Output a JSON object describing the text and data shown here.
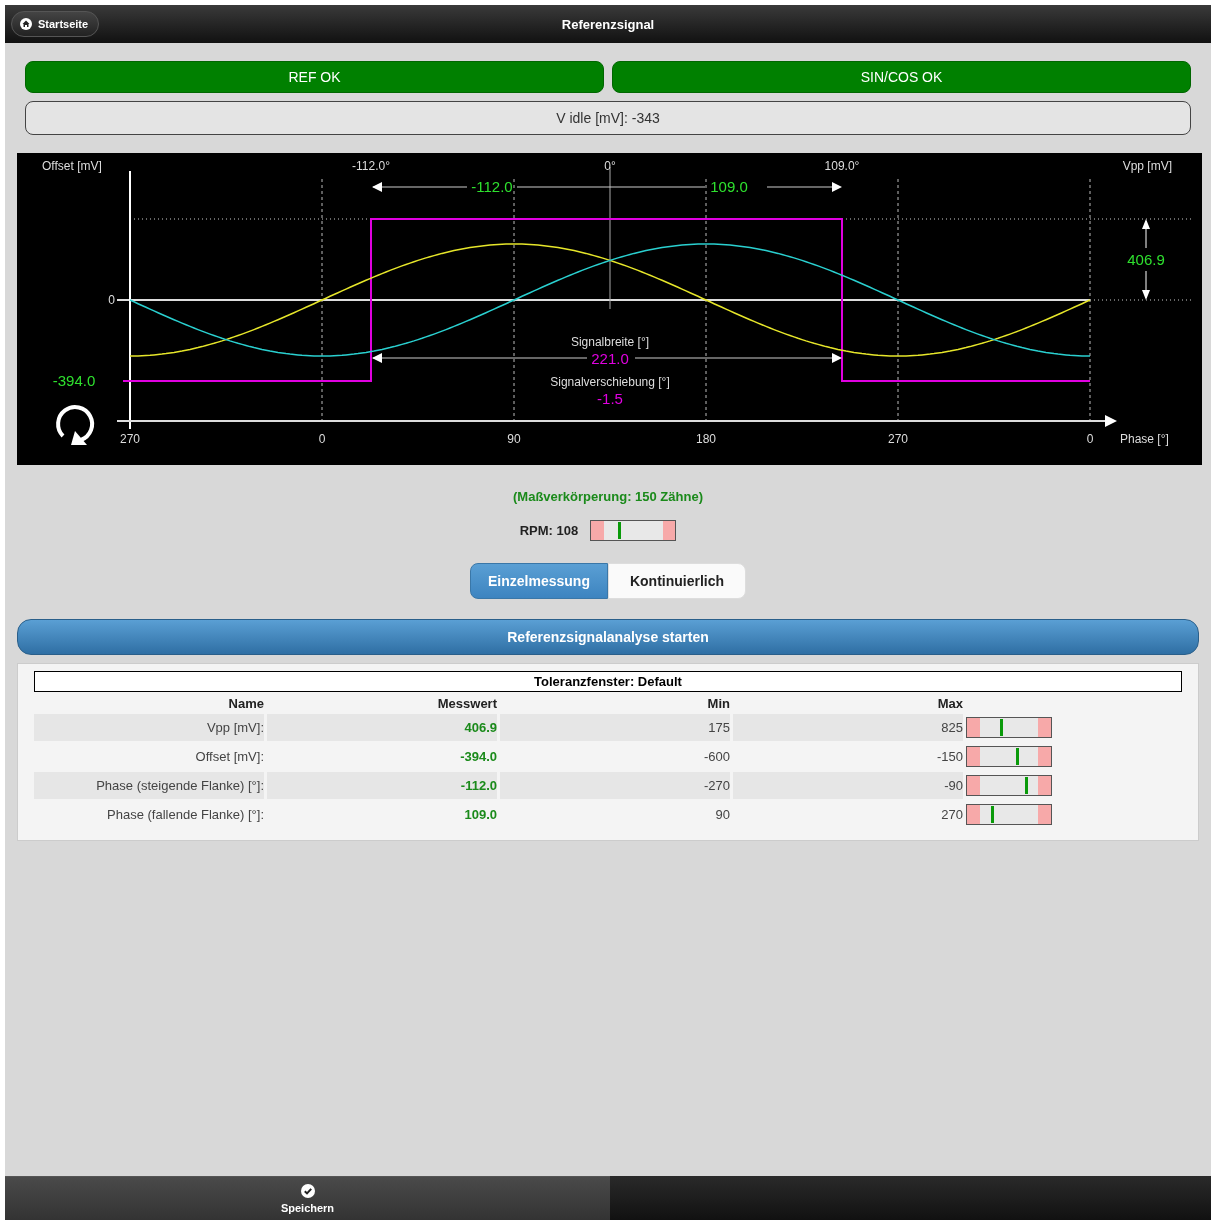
{
  "header": {
    "home_button": "Startseite",
    "title": "Referenzsignal"
  },
  "status_buttons": [
    "REF OK",
    "SIN/COS OK"
  ],
  "idle_field": "V idle [mV]: -343",
  "scope": {
    "left_axis_label": "Offset [mV]",
    "right_axis_label": "Vpp [mV]",
    "x_axis_label": "Phase [°]",
    "y_tick": "0",
    "x_ticks": [
      "270",
      "0",
      "90",
      "180",
      "270",
      "0"
    ],
    "top_markers": [
      "-112.0°",
      "0°",
      "109.0°"
    ],
    "rise_value": "-112.0",
    "fall_value": "109.0",
    "amplitude_value": "406.9",
    "offset_value": "-394.0",
    "width_label": "Signalbreite [°]",
    "width_value": "221.0",
    "shift_label": "Signalverschiebung [°]",
    "shift_value": "-1.5"
  },
  "teeth_note": "(Maßverkörperung: 150 Zähne)",
  "rpm": {
    "label": "RPM: 108",
    "level": 0.33
  },
  "modes": [
    {
      "label": "Einzelmessung",
      "selected": true
    },
    {
      "label": "Kontinuierlich",
      "selected": false
    }
  ],
  "start_button": "Referenzsignalanalyse starten",
  "tolerance": {
    "title": "Toleranzfenster: Default",
    "columns": [
      "Name",
      "Messwert",
      "Min",
      "Max"
    ],
    "rows": [
      {
        "name": "Vpp [mV]:",
        "value": "406.9",
        "min": "175",
        "max": "825",
        "level": 0.4
      },
      {
        "name": "Offset [mV]:",
        "value": "-394.0",
        "min": "-600",
        "max": "-150",
        "level": 0.6
      },
      {
        "name": "Phase (steigende Flanke) [°]:",
        "value": "-112.0",
        "min": "-270",
        "max": "-90",
        "level": 0.7
      },
      {
        "name": "Phase (fallende Flanke) [°]:",
        "value": "109.0",
        "min": "90",
        "max": "270",
        "level": 0.3
      }
    ]
  },
  "footer": {
    "save_button": "Speichern"
  }
}
